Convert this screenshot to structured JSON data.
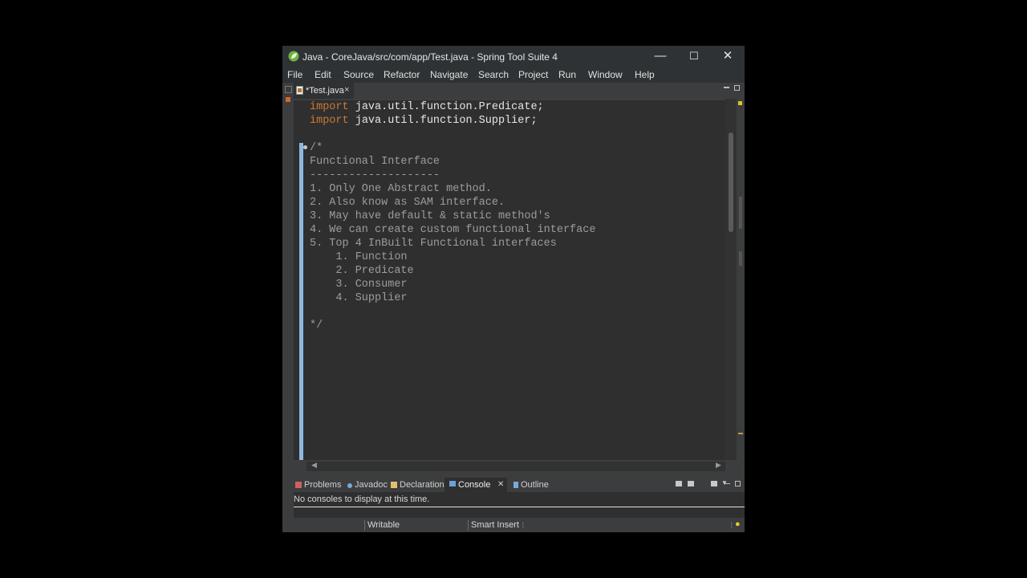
{
  "window": {
    "title": "Java - CoreJava/src/com/app/Test.java - Spring Tool Suite 4",
    "controls": {
      "minimize": "—",
      "maximize": "☐",
      "close": "✕"
    }
  },
  "menu": [
    "File",
    "Edit",
    "Source",
    "Refactor",
    "Navigate",
    "Search",
    "Project",
    "Run",
    "Window",
    "Help"
  ],
  "editor_tab": {
    "label": "*Test.java",
    "close": "×"
  },
  "code": {
    "import1_kw": "import",
    "import1": "java.util.function.Predicate;",
    "import2_kw": "import",
    "import2": "java.util.function.Supplier;",
    "comment_lines": [
      "/*",
      "Functional Interface",
      "--------------------",
      "1. Only One Abstract method.",
      "2. Also know as SAM interface.",
      "3. May have default & static method's",
      "4. We can create custom functional interface",
      "5. Top 4 InBuilt Functional interfaces",
      "    1. Function",
      "    2. Predicate",
      "    3. Consumer",
      "    4. Supplier",
      "",
      "*/"
    ]
  },
  "bottom_tabs": {
    "problems": "Problems",
    "javadoc": "Javadoc",
    "declaration": "Declaration",
    "console": "Console",
    "console_close": "✕",
    "outline": "Outline"
  },
  "console": {
    "message": "No consoles to display at this time."
  },
  "status": {
    "writable": "Writable",
    "insert_mode": "Smart Insert"
  },
  "colors": {
    "keyword": "#cc7832",
    "comment": "#9c9c9c",
    "editor_bg": "#2f2f2f",
    "chrome_bg": "#3b3d3f",
    "titlebar_bg": "#2e3234"
  }
}
